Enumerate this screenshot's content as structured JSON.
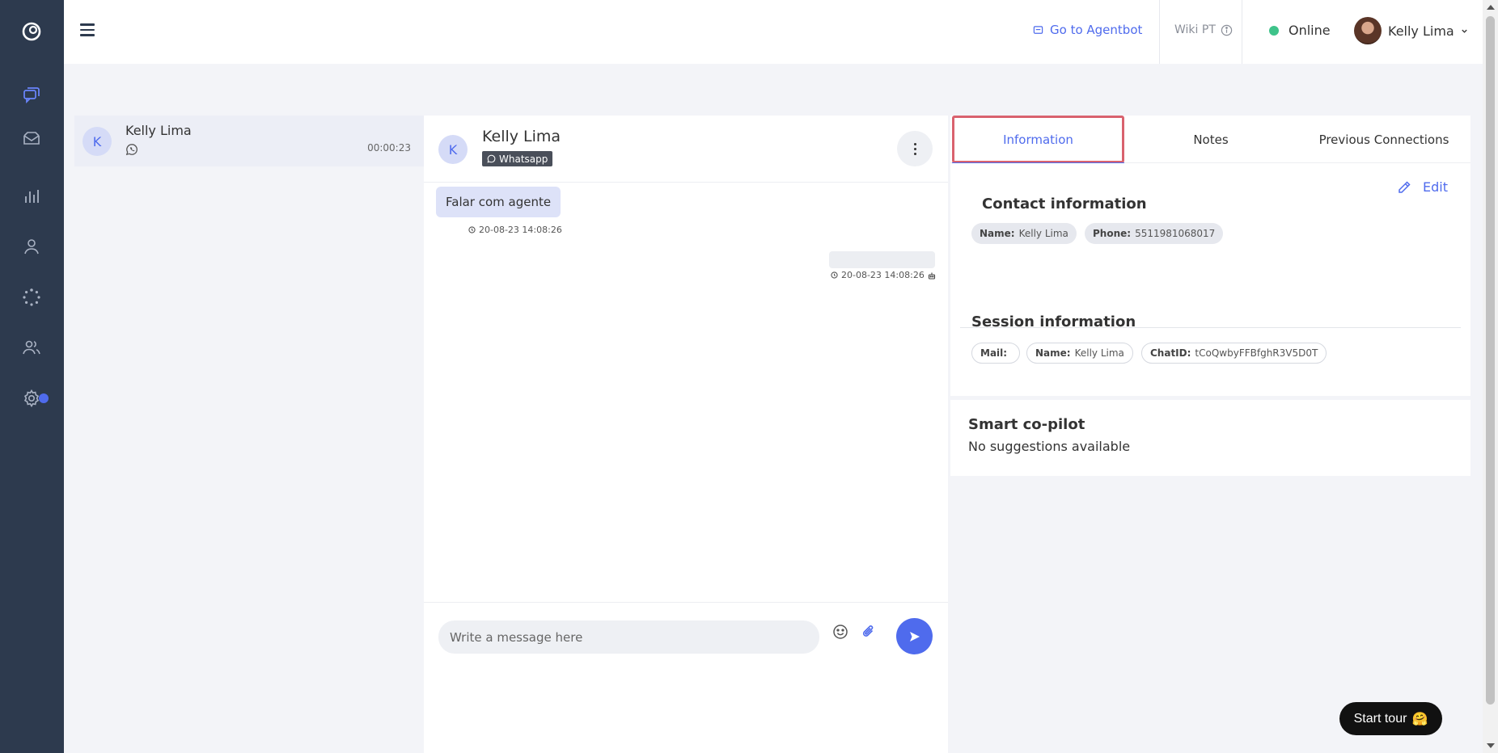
{
  "colors": {
    "accent": "#4f6bed",
    "sidebar": "#2d3a4e",
    "online": "#3ec38a",
    "highlight_border": "#d9626e"
  },
  "sidebar": {
    "logo_icon": "logo-icon",
    "items": [
      {
        "icon": "chat-bubbles-icon",
        "active": true
      },
      {
        "icon": "mail-icon"
      },
      {
        "icon": "bar-chart-icon"
      },
      {
        "icon": "user-icon"
      },
      {
        "icon": "loading-dots-icon"
      },
      {
        "icon": "users-icon"
      },
      {
        "icon": "gear-icon",
        "has_notification": true
      }
    ]
  },
  "topbar": {
    "agentbot_label": "Go to Agentbot",
    "wiki_label": "Wiki PT",
    "status_label": "Online",
    "user_name": "Kelly Lima"
  },
  "conversation_list": [
    {
      "avatar_letter": "K",
      "name": "Kelly Lima",
      "channel_icon": "whatsapp-icon",
      "timer": "00:00:23",
      "selected": true
    }
  ],
  "chat": {
    "avatar_letter": "K",
    "contact_name": "Kelly Lima",
    "channel_badge": "Whatsapp",
    "messages": [
      {
        "direction": "in",
        "text": "Falar com agente",
        "timestamp": "20-08-23 14:08:26"
      },
      {
        "direction": "out",
        "text": "",
        "timestamp": "20-08-23 14:08:26"
      }
    ],
    "input_placeholder": "Write a message here"
  },
  "right_panel": {
    "tabs": [
      {
        "label": "Information",
        "active": true
      },
      {
        "label": "Notes"
      },
      {
        "label": "Previous Connections"
      }
    ],
    "edit_label": "Edit",
    "contact_info": {
      "title": "Contact information",
      "fields": [
        {
          "key": "Name:",
          "value": "Kelly Lima"
        },
        {
          "key": "Phone:",
          "value": "5511981068017"
        }
      ]
    },
    "session_info": {
      "title": "Session information",
      "fields": [
        {
          "key": "Mail:",
          "value": ""
        },
        {
          "key": "Name:",
          "value": "Kelly Lima"
        },
        {
          "key": "ChatID:",
          "value": "tCoQwbyFFBfghR3V5D0T"
        }
      ]
    },
    "copilot": {
      "title": "Smart co-pilot",
      "text": "No suggestions available"
    }
  },
  "tour_button": {
    "label": "Start tour",
    "emoji": "🤗"
  }
}
